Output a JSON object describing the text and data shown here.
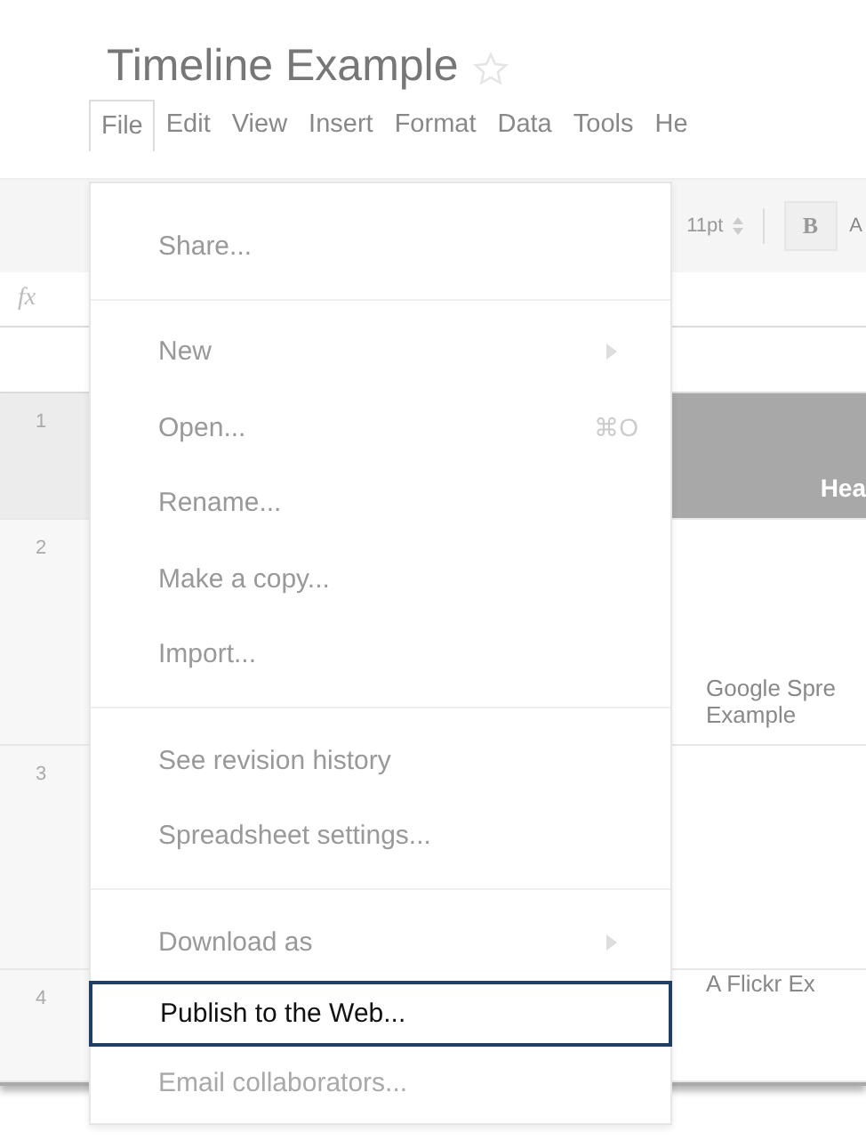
{
  "document": {
    "title": "Timeline Example",
    "starred": false
  },
  "menu_bar": [
    {
      "label": "File",
      "selected": true
    },
    {
      "label": "Edit",
      "selected": false
    },
    {
      "label": "View",
      "selected": false
    },
    {
      "label": "Insert",
      "selected": false
    },
    {
      "label": "Format",
      "selected": false
    },
    {
      "label": "Data",
      "selected": false
    },
    {
      "label": "Tools",
      "selected": false
    },
    {
      "label": "He",
      "selected": false
    }
  ],
  "toolbar": {
    "font_size": "11pt",
    "bold_button": "B",
    "next_button": "A"
  },
  "formula_bar": {
    "label": "fx"
  },
  "rows": [
    {
      "number": "1",
      "cell_lines": [
        "Hea"
      ],
      "kind": "header"
    },
    {
      "number": "2",
      "cell_lines": [
        "Google Spre",
        "Example"
      ],
      "kind": "data"
    },
    {
      "number": "3",
      "cell_lines": [],
      "kind": "data"
    },
    {
      "number": "4",
      "cell_lines": [
        "A Flickr Ex"
      ],
      "kind": "data"
    }
  ],
  "file_menu": [
    {
      "kind": "item",
      "label": "Share...",
      "selected": false
    },
    {
      "kind": "separator"
    },
    {
      "kind": "item",
      "label": "New",
      "submenu": true,
      "selected": false
    },
    {
      "kind": "item",
      "label": "Open...",
      "shortcut": "⌘O",
      "selected": false
    },
    {
      "kind": "item",
      "label": "Rename...",
      "selected": false
    },
    {
      "kind": "item",
      "label": "Make a copy...",
      "selected": false
    },
    {
      "kind": "item",
      "label": "Import...",
      "selected": false
    },
    {
      "kind": "separator"
    },
    {
      "kind": "item",
      "label": "See revision history",
      "selected": false
    },
    {
      "kind": "item",
      "label": "Spreadsheet settings...",
      "selected": false
    },
    {
      "kind": "separator"
    },
    {
      "kind": "item",
      "label": "Download as",
      "submenu": true,
      "selected": false
    },
    {
      "kind": "item",
      "label": "Publish to the Web...",
      "selected": true
    },
    {
      "kind": "item",
      "label": "Email collaborators...",
      "selected": false,
      "faded": true
    }
  ]
}
